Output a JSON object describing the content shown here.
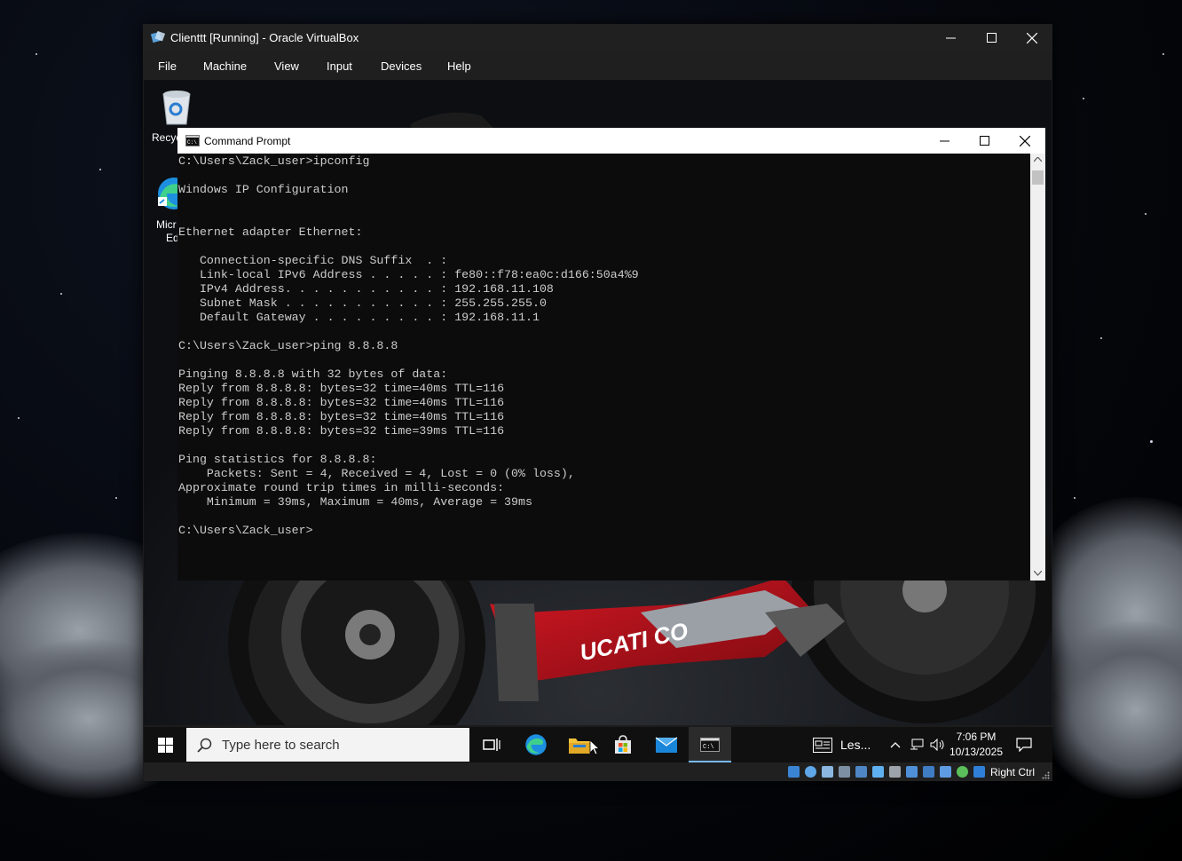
{
  "vbox": {
    "title": "Clienttt [Running] - Oracle VirtualBox",
    "menu": [
      "File",
      "Machine",
      "View",
      "Input",
      "Devices",
      "Help"
    ],
    "host_key": "Right Ctrl"
  },
  "desktop": {
    "icons": [
      {
        "label": "Recyc",
        "icon": "recycle-bin-icon"
      },
      {
        "label": "Micr",
        "label2": "Ed",
        "icon": "edge-icon"
      }
    ],
    "wallpaper_text": "UCATI CO"
  },
  "cmd": {
    "title": "Command Prompt",
    "output": "C:\\Users\\Zack_user>ipconfig\n\nWindows IP Configuration\n\n\nEthernet adapter Ethernet:\n\n   Connection-specific DNS Suffix  . :\n   Link-local IPv6 Address . . . . . : fe80::f78:ea0c:d166:50a4%9\n   IPv4 Address. . . . . . . . . . . : 192.168.11.108\n   Subnet Mask . . . . . . . . . . . : 255.255.255.0\n   Default Gateway . . . . . . . . . : 192.168.11.1\n\nC:\\Users\\Zack_user>ping 8.8.8.8\n\nPinging 8.8.8.8 with 32 bytes of data:\nReply from 8.8.8.8: bytes=32 time=40ms TTL=116\nReply from 8.8.8.8: bytes=32 time=40ms TTL=116\nReply from 8.8.8.8: bytes=32 time=40ms TTL=116\nReply from 8.8.8.8: bytes=32 time=39ms TTL=116\n\nPing statistics for 8.8.8.8:\n    Packets: Sent = 4, Received = 4, Lost = 0 (0% loss),\nApproximate round trip times in milli-seconds:\n    Minimum = 39ms, Maximum = 40ms, Average = 39ms\n\nC:\\Users\\Zack_user>"
  },
  "taskbar": {
    "search_placeholder": "Type here to search",
    "news_label": "Les...",
    "time": "7:06 PM",
    "date": "10/13/2025",
    "apps": [
      "task-view-icon",
      "edge-icon",
      "file-explorer-icon",
      "store-icon",
      "mail-icon",
      "cmd-icon"
    ]
  },
  "colors": {
    "accent": "#76b9ed",
    "cmd_text": "#cccccc",
    "ducati_red": "#c8101d"
  }
}
